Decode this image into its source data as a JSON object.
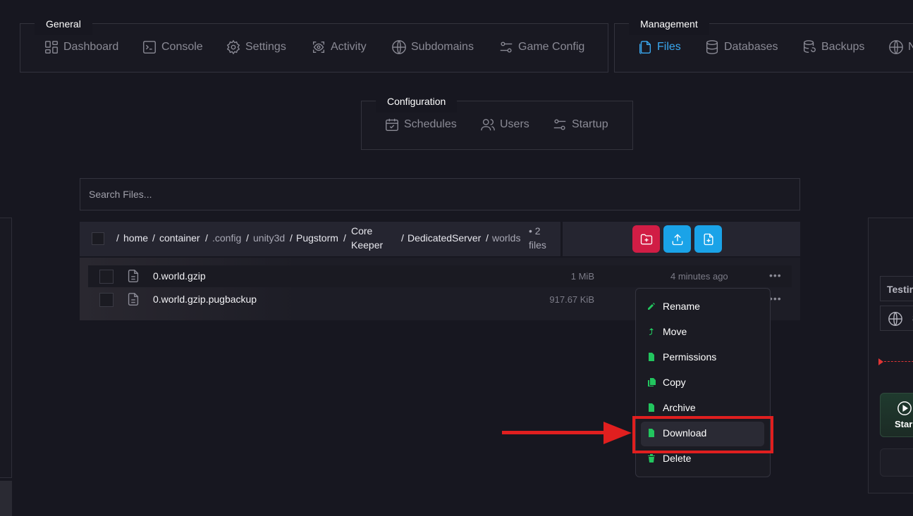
{
  "general": {
    "label": "General",
    "items": [
      {
        "label": "Dashboard",
        "icon": "dashboard-icon"
      },
      {
        "label": "Console",
        "icon": "console-icon"
      },
      {
        "label": "Settings",
        "icon": "gear-icon"
      },
      {
        "label": "Activity",
        "icon": "activity-icon"
      },
      {
        "label": "Subdomains",
        "icon": "globe-icon"
      },
      {
        "label": "Game Config",
        "icon": "sliders-icon"
      }
    ]
  },
  "management": {
    "label": "Management",
    "items": [
      {
        "label": "Files",
        "icon": "files-icon",
        "active": true
      },
      {
        "label": "Databases",
        "icon": "database-icon"
      },
      {
        "label": "Backups",
        "icon": "backup-icon"
      },
      {
        "label": "N",
        "icon": "globe-icon"
      }
    ]
  },
  "configuration": {
    "label": "Configuration",
    "items": [
      {
        "label": "Schedules",
        "icon": "calendar-icon"
      },
      {
        "label": "Users",
        "icon": "users-icon"
      },
      {
        "label": "Startup",
        "icon": "sliders-icon"
      }
    ]
  },
  "search": {
    "placeholder": "Search Files..."
  },
  "breadcrumb": {
    "parts": [
      "home",
      "container",
      ".config",
      "unity3d",
      "Pugstorm",
      "Core",
      "Keeper",
      "DedicatedServer",
      "worlds"
    ],
    "separator": "/",
    "count_line1": "• 2",
    "count_line2": "files"
  },
  "actions": {
    "new_folder_color": "#d11d45",
    "upload_color": "#1aa3e8",
    "new_file_color": "#1aa3e8"
  },
  "files": [
    {
      "name": "0.world.gzip",
      "size": "1 MiB",
      "modified": "4 minutes ago"
    },
    {
      "name": "0.world.gzip.pugbackup",
      "size": "917.67 KiB",
      "modified": ""
    }
  ],
  "context_menu": {
    "items": [
      "Rename",
      "Move",
      "Permissions",
      "Copy",
      "Archive",
      "Download",
      "Delete"
    ],
    "highlighted": "Download",
    "icon_color": "#22c55e"
  },
  "right_panel": {
    "field_text": "Testir",
    "address_fragment": "8",
    "start_label": "Star"
  },
  "annotation": {
    "arrow_color": "#e01f1f"
  }
}
